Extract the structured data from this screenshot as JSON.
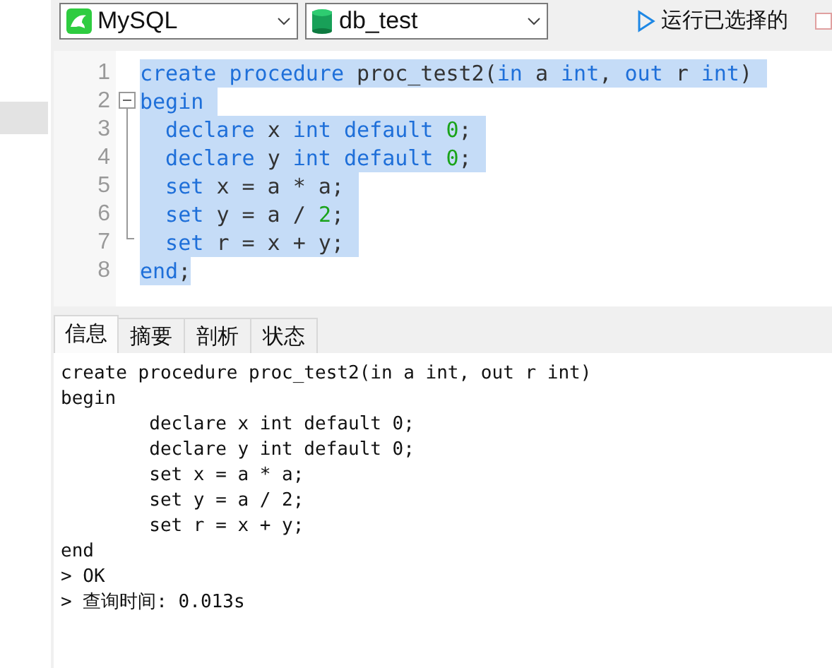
{
  "toolbar": {
    "connection": {
      "value": "MySQL"
    },
    "database": {
      "value": "db_test"
    },
    "run_button": {
      "label": "运行已选择的"
    },
    "checkbox": {
      "checked": false
    }
  },
  "fold_marker": {
    "expanded": true
  },
  "editor": {
    "lines": [
      {
        "number": "1",
        "selected": true,
        "tokens": [
          {
            "kind": "keyword",
            "text": "create procedure "
          },
          {
            "kind": "plain",
            "text": "proc_test2("
          },
          {
            "kind": "keyword",
            "text": "in "
          },
          {
            "kind": "plain",
            "text": "a "
          },
          {
            "kind": "keyword",
            "text": "int"
          },
          {
            "kind": "plain",
            "text": ", "
          },
          {
            "kind": "keyword",
            "text": "out "
          },
          {
            "kind": "plain",
            "text": "r "
          },
          {
            "kind": "keyword",
            "text": "int"
          },
          {
            "kind": "plain",
            "text": ")"
          }
        ]
      },
      {
        "number": "2",
        "selected": true,
        "tokens": [
          {
            "kind": "keyword",
            "text": "begin"
          }
        ]
      },
      {
        "number": "3",
        "selected": true,
        "tokens": [
          {
            "kind": "keyword",
            "text": "  declare "
          },
          {
            "kind": "plain",
            "text": "x "
          },
          {
            "kind": "keyword",
            "text": "int default "
          },
          {
            "kind": "number",
            "text": "0"
          },
          {
            "kind": "plain",
            "text": ";"
          }
        ]
      },
      {
        "number": "4",
        "selected": true,
        "tokens": [
          {
            "kind": "keyword",
            "text": "  declare "
          },
          {
            "kind": "plain",
            "text": "y "
          },
          {
            "kind": "keyword",
            "text": "int default "
          },
          {
            "kind": "number",
            "text": "0"
          },
          {
            "kind": "plain",
            "text": ";"
          }
        ]
      },
      {
        "number": "5",
        "selected": true,
        "tokens": [
          {
            "kind": "keyword",
            "text": "  set "
          },
          {
            "kind": "plain",
            "text": "x = a * a;"
          }
        ]
      },
      {
        "number": "6",
        "selected": true,
        "tokens": [
          {
            "kind": "keyword",
            "text": "  set "
          },
          {
            "kind": "plain",
            "text": "y = a / "
          },
          {
            "kind": "number",
            "text": "2"
          },
          {
            "kind": "plain",
            "text": ";"
          }
        ]
      },
      {
        "number": "7",
        "selected": true,
        "tokens": [
          {
            "kind": "keyword",
            "text": "  set "
          },
          {
            "kind": "plain",
            "text": "r = x + y;"
          }
        ]
      },
      {
        "number": "8",
        "selected": true,
        "tokens": [
          {
            "kind": "keyword",
            "text": "end"
          },
          {
            "kind": "plain",
            "text": ";"
          }
        ]
      }
    ]
  },
  "result_tabs": [
    {
      "label": "信息",
      "selected": true
    },
    {
      "label": "摘要",
      "selected": false
    },
    {
      "label": "剖析",
      "selected": false
    },
    {
      "label": "状态",
      "selected": false
    }
  ],
  "output": {
    "lines": [
      "create procedure proc_test2(in a int, out r int)",
      "begin",
      "        declare x int default 0;",
      "        declare y int default 0;",
      "        set x = a * a;",
      "        set y = a / 2;",
      "        set r = x + y;",
      "end",
      "> OK",
      "> 查询时间: 0.013s"
    ]
  }
}
